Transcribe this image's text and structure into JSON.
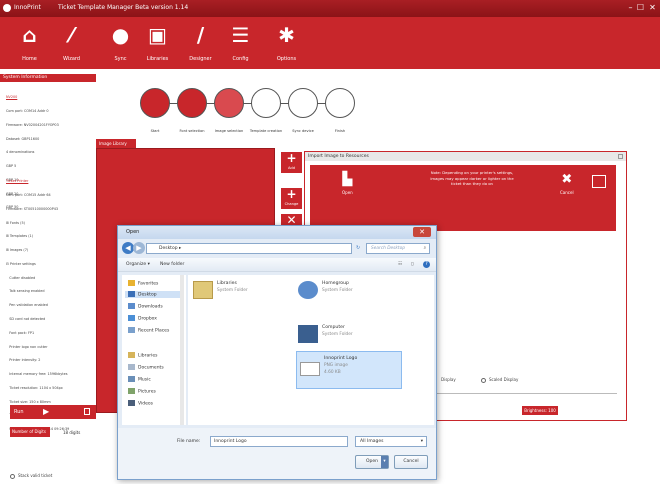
{
  "window": {
    "app_name": "InnoPrint",
    "title": "Ticket Template Manager Beta version 1.14",
    "minimize": "–",
    "restore": "☐",
    "close": "✕"
  },
  "toolbar": {
    "items": [
      {
        "label": "Home",
        "icon": "home-icon"
      },
      {
        "label": "Wizard",
        "icon": "wand-icon"
      },
      {
        "label": "Sync",
        "icon": "sync-icon"
      },
      {
        "label": "Libraries",
        "icon": "briefcase-icon"
      },
      {
        "label": "Designer",
        "icon": "pen-icon"
      },
      {
        "label": "Config",
        "icon": "list-icon"
      },
      {
        "label": "Options",
        "icon": "gear-icon"
      }
    ]
  },
  "sidebar": {
    "header": "System Information",
    "section1_title": "NV200",
    "section1_lines": [
      "Com port: COM14 Addr 0",
      "Firmware: NV02004201FYOP03",
      "Dataset: GBP11600",
      "4 denominations",
      "GBP 5",
      "GBP 10",
      "GBP 20",
      "GBP 50"
    ],
    "section2_title": "Ticket Printer",
    "section2_lines": [
      "Com port: COM15 Addr 64",
      "Firmware: ST00510000000P43",
      "⊞ Fonts (5)",
      "⊞ Templates (1)",
      "⊞ Images (7)",
      "⊟ Printer settings",
      "   Cutter disabled",
      "   Talk sensing enabled",
      "   Pen validation enabled",
      "   SD card not detected",
      "   Font pack: FP1",
      "   Printer logo non cutter",
      "   Printer intensity: 2",
      "   Internal memory free: 1596kbytes",
      "   Ticket resolution: 1104 x 504px",
      "   Ticket size: 150 x 80mm",
      "   Ticket pixel offset: 80,26",
      "   System Time: 23/04/2014 09:26:39"
    ]
  },
  "wizard": {
    "steps": [
      "Start",
      "Font selection",
      "Image selection",
      "Template creation",
      "Sync device",
      "Finish"
    ]
  },
  "image_library": {
    "tab": "Image Library"
  },
  "side_buttons": [
    {
      "label": "Add"
    },
    {
      "label": "Change"
    },
    {
      "label": "Delete"
    }
  ],
  "import_panel": {
    "title": "Import Image to Resources",
    "open_label": "Open",
    "cancel_label": "Cancel",
    "note": "Note: Depending on your printer's settings, images may appear darker or lighter on the ticket than they do on",
    "display_label": "Display",
    "scaled_display": "Scaled Display",
    "brightness": "Brightness: 100"
  },
  "dialog": {
    "title": "Open",
    "address": "Desktop ▸",
    "search_placeholder": "Search Desktop",
    "organize": "Organize ▾",
    "new_folder": "New folder",
    "nav_items": [
      "Favorites",
      "Desktop",
      "Downloads",
      "Dropbox",
      "Recent Places",
      "Libraries",
      "Documents",
      "Music",
      "Pictures",
      "Videos"
    ],
    "files": [
      {
        "name": "Libraries",
        "type": "System Folder"
      },
      {
        "name": "Homegroup",
        "type": "System Folder"
      },
      {
        "name": "Computer",
        "type": "System Folder"
      },
      {
        "name": "Innoprint Logo",
        "type": "PNG image",
        "size": "4.60 KB"
      }
    ],
    "file_name_label": "File name:",
    "file_name_value": "Innoprint Logo",
    "file_type": "All Images",
    "open_button": "Open",
    "cancel_button": "Cancel"
  },
  "run_panel": {
    "run_label": "Run",
    "digits_label": "Number of Digits",
    "digits_value": "18 digits"
  },
  "stack_valid": "Stack valid ticket",
  "colors": {
    "brand_red": "#c8262b",
    "dialog_blue": "#e4ecf6"
  }
}
